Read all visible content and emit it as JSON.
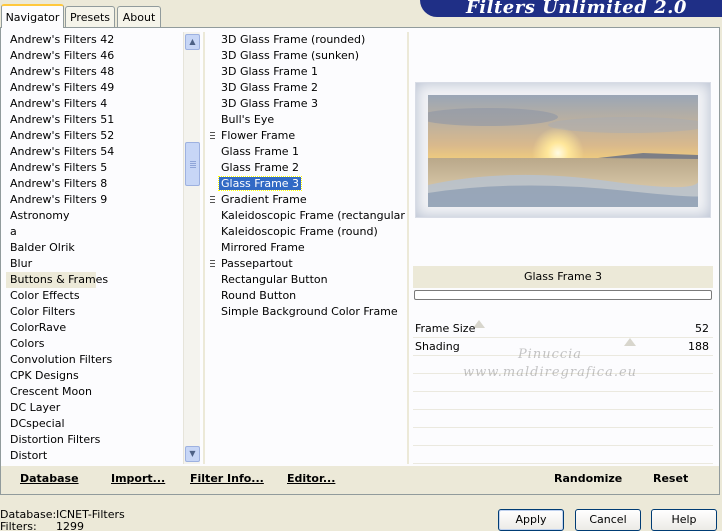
{
  "tabs": [
    {
      "label": "Navigator",
      "active": true
    },
    {
      "label": "Presets",
      "active": false
    },
    {
      "label": "About",
      "active": false
    }
  ],
  "brand_title": "Filters Unlimited 2.0",
  "categories": [
    "Andrew's Filters 42",
    "Andrew's Filters 46",
    "Andrew's Filters 48",
    "Andrew's Filters 49",
    "Andrew's Filters 4",
    "Andrew's Filters 51",
    "Andrew's Filters 52",
    "Andrew's Filters 54",
    "Andrew's Filters 5",
    "Andrew's Filters 8",
    "Andrew's Filters 9",
    "Astronomy",
    "a",
    "Balder Olrik",
    "Blur",
    "Buttons & Frames",
    "Color Effects",
    "Color Filters",
    "ColorRave",
    "Colors",
    "Convolution Filters",
    "CPK Designs",
    "Crescent Moon",
    "DC Layer",
    "DCspecial",
    "Distortion Filters",
    "Distort"
  ],
  "selected_category": "Buttons & Frames",
  "filters": [
    {
      "label": "3D Glass Frame (rounded)",
      "marker": false
    },
    {
      "label": "3D Glass Frame (sunken)",
      "marker": false
    },
    {
      "label": "3D Glass Frame 1",
      "marker": false
    },
    {
      "label": "3D Glass Frame 2",
      "marker": false
    },
    {
      "label": "3D Glass Frame 3",
      "marker": false
    },
    {
      "label": "Bull's Eye",
      "marker": false
    },
    {
      "label": "Flower Frame",
      "marker": true
    },
    {
      "label": "Glass Frame 1",
      "marker": false
    },
    {
      "label": "Glass Frame 2",
      "marker": false
    },
    {
      "label": "Glass Frame 3",
      "marker": false
    },
    {
      "label": "Gradient Frame",
      "marker": true
    },
    {
      "label": "Kaleidoscopic Frame (rectangular)",
      "marker": false
    },
    {
      "label": "Kaleidoscopic Frame (round)",
      "marker": false
    },
    {
      "label": "Mirrored Frame",
      "marker": false
    },
    {
      "label": "Passepartout",
      "marker": true
    },
    {
      "label": "Rectangular Button",
      "marker": false
    },
    {
      "label": "Round Button",
      "marker": false
    },
    {
      "label": "Simple Background Color Frame",
      "marker": false
    }
  ],
  "selected_filter": "Glass Frame 3",
  "preview": {
    "filter_name": "Glass Frame 3"
  },
  "params": [
    {
      "label": "Frame Size",
      "value": "52",
      "slider_fraction": 0.2
    },
    {
      "label": "Shading",
      "value": "188",
      "slider_fraction": 0.74
    }
  ],
  "watermark": {
    "line1": "Pinuccia",
    "line2": "www.maldiregrafica.eu"
  },
  "bottom_buttons": {
    "database": "Database",
    "import": "Import...",
    "filter_info": "Filter Info...",
    "editor": "Editor...",
    "randomize": "Randomize",
    "reset": "Reset"
  },
  "status": {
    "database_label": "Database:",
    "database_value": "ICNET-Filters",
    "filters_label": "Filters:",
    "filters_value": "1299"
  },
  "dialog_buttons": {
    "apply": "Apply",
    "cancel": "Cancel",
    "help": "Help"
  },
  "colors": {
    "selection": "#316ac5",
    "brand": "#1f2f86",
    "panel": "#ece9d8"
  }
}
